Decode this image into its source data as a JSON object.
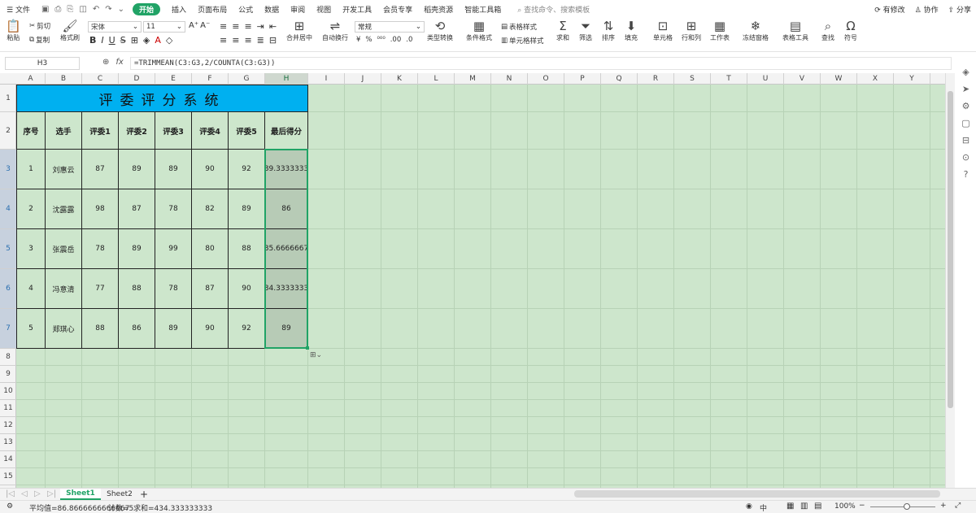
{
  "menubar": {
    "file": "文件",
    "tabs": [
      "开始",
      "插入",
      "页面布局",
      "公式",
      "数据",
      "审阅",
      "视图",
      "开发工具",
      "会员专享",
      "稻壳资源",
      "智能工具箱"
    ],
    "search_placeholder": "查找命令、搜索模板",
    "modified": "有修改",
    "collaborate": "协作",
    "share": "分享"
  },
  "ribbon": {
    "paste": "粘贴",
    "cut": "剪切",
    "copy": "复制",
    "format_painter": "格式刷",
    "font_name": "宋体",
    "font_size": "11",
    "merge_center": "合并居中",
    "wrap_text": "自动换行",
    "number_format": "常规",
    "type_convert": "类型转换",
    "conditional_format": "条件格式",
    "table_style": "表格样式",
    "cell_style": "单元格样式",
    "sum": "求和",
    "filter": "筛选",
    "sort": "排序",
    "fill": "填充",
    "cells": "单元格",
    "rows_cols": "行和列",
    "worksheet": "工作表",
    "freeze": "冻结窗格",
    "table_tools": "表格工具",
    "find": "查找",
    "symbol": "符号"
  },
  "formula_bar": {
    "name_box": "H3",
    "formula": "=TRIMMEAN(C3:G3,2/COUNTA(C3:G3))"
  },
  "columns": [
    "A",
    "B",
    "C",
    "D",
    "E",
    "F",
    "G",
    "H",
    "I",
    "J",
    "K",
    "L",
    "M",
    "N",
    "O",
    "P",
    "Q",
    "R",
    "S",
    "T",
    "U",
    "V",
    "W",
    "X",
    "Y"
  ],
  "rows": [
    "1",
    "2",
    "3",
    "4",
    "5",
    "6",
    "7",
    "8",
    "9",
    "10",
    "11",
    "12",
    "13",
    "14",
    "15"
  ],
  "table": {
    "title": "评委评分系统",
    "headers": [
      "序号",
      "选手",
      "评委1",
      "评委2",
      "评委3",
      "评委4",
      "评委5",
      "最后得分"
    ],
    "rows": [
      [
        "1",
        "刘惠云",
        "87",
        "89",
        "89",
        "90",
        "92",
        "89.3333333"
      ],
      [
        "2",
        "沈露露",
        "98",
        "87",
        "78",
        "82",
        "89",
        "86"
      ],
      [
        "3",
        "张震岳",
        "78",
        "89",
        "99",
        "80",
        "88",
        "85.6666667"
      ],
      [
        "4",
        "冯意清",
        "77",
        "88",
        "78",
        "87",
        "90",
        "84.3333333"
      ],
      [
        "5",
        "郑琪心",
        "88",
        "86",
        "89",
        "90",
        "92",
        "89"
      ]
    ]
  },
  "sheets": [
    "Sheet1",
    "Sheet2"
  ],
  "status": {
    "average": "平均值=86.8666666666667",
    "count": "计数=5",
    "sum": "求和=434.333333333",
    "zoom": "100%",
    "ime": "中"
  },
  "colors": {
    "accent": "#21a366",
    "title_fill": "#00b0f0",
    "grid_bg": "#cde6cc",
    "score_fill": "#b7cbb6"
  }
}
